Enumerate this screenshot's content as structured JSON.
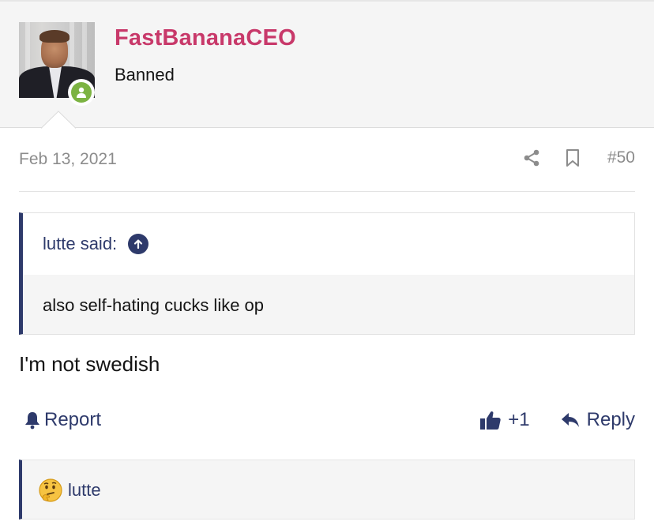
{
  "post": {
    "author": {
      "username": "FastBananaCEO",
      "title": "Banned",
      "status_color": "#7cb342",
      "username_color": "#c8396a"
    },
    "date": "Feb 13, 2021",
    "number": "#50",
    "quote": {
      "attribution": "lutte said:",
      "text": "also self-hating cucks like op"
    },
    "body": "I'm not swedish",
    "actions": {
      "report_label": "Report",
      "like_count": "+1",
      "reply_label": "Reply"
    },
    "reactions": {
      "user": "lutte",
      "emoji": "thinking-face-icon"
    }
  },
  "colors": {
    "accent": "#2e3a6b",
    "meta_text": "#8c8c8c",
    "header_bg": "#f5f5f5"
  }
}
